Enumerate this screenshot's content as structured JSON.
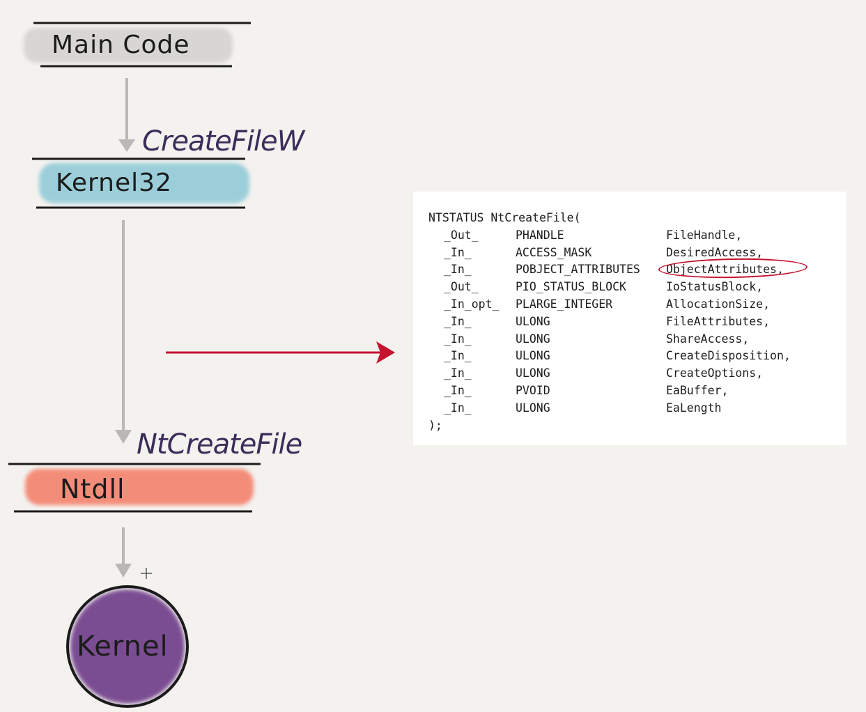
{
  "layers": {
    "main_code": {
      "label": "Main Code",
      "fill": "#d7d6d2"
    },
    "kernel32": {
      "label": "Kernel32",
      "fill": "#7fc3d3"
    },
    "ntdll": {
      "label": "Ntdll",
      "fill": "#f4826c"
    },
    "kernel": {
      "label": "Kernel",
      "fill": "#7a4e92"
    }
  },
  "calls": {
    "to_kernel32": "CreateFileW",
    "to_ntdll": "NtCreateFile"
  },
  "colors": {
    "ink": "#1b1b1b",
    "flow_arrow": "#b9b8b4",
    "pointer_arrow": "#c4122f",
    "call_ink": "#3c2d5a",
    "highlight_circle": "#c4122f"
  },
  "code": {
    "signature": "NTSTATUS NtCreateFile(",
    "params": [
      {
        "annotation": "_Out_",
        "type": "PHANDLE",
        "name": "FileHandle,"
      },
      {
        "annotation": "_In_",
        "type": "ACCESS_MASK",
        "name": "DesiredAccess,"
      },
      {
        "annotation": "_In_",
        "type": "POBJECT_ATTRIBUTES",
        "name": "ObjectAttributes,",
        "highlighted": true
      },
      {
        "annotation": "_Out_",
        "type": "PIO_STATUS_BLOCK",
        "name": "IoStatusBlock,"
      },
      {
        "annotation": "_In_opt_",
        "type": "PLARGE_INTEGER",
        "name": "AllocationSize,"
      },
      {
        "annotation": "_In_",
        "type": "ULONG",
        "name": "FileAttributes,"
      },
      {
        "annotation": "_In_",
        "type": "ULONG",
        "name": "ShareAccess,"
      },
      {
        "annotation": "_In_",
        "type": "ULONG",
        "name": "CreateDisposition,"
      },
      {
        "annotation": "_In_",
        "type": "ULONG",
        "name": "CreateOptions,"
      },
      {
        "annotation": "_In_",
        "type": "PVOID",
        "name": "EaBuffer,"
      },
      {
        "annotation": "_In_",
        "type": "ULONG",
        "name": "EaLength"
      }
    ],
    "closing": ");"
  }
}
